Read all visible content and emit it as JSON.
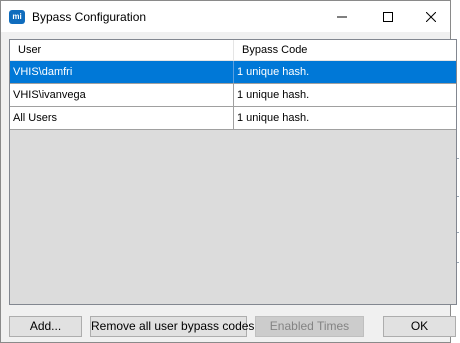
{
  "window": {
    "title": "Bypass Configuration",
    "app_icon_text": "mi",
    "controls": [
      "minimize",
      "maximize",
      "close"
    ]
  },
  "grid": {
    "columns": [
      "User",
      "Bypass Code"
    ],
    "rows": [
      {
        "user": "VHIS\\damfri",
        "bypass_code": "1 unique hash.",
        "selected": true
      },
      {
        "user": "VHIS\\ivanvega",
        "bypass_code": "1 unique hash.",
        "selected": false
      },
      {
        "user": "All Users",
        "bypass_code": "1 unique hash.",
        "selected": false
      }
    ]
  },
  "buttons": {
    "add": "Add...",
    "remove_all": "Remove all user bypass codes",
    "enabled_times": "Enabled Times",
    "ok": "OK"
  },
  "colors": {
    "selection": "#0078d7",
    "app_icon": "#0f6cbd",
    "grid_background": "#dcdcdc"
  }
}
